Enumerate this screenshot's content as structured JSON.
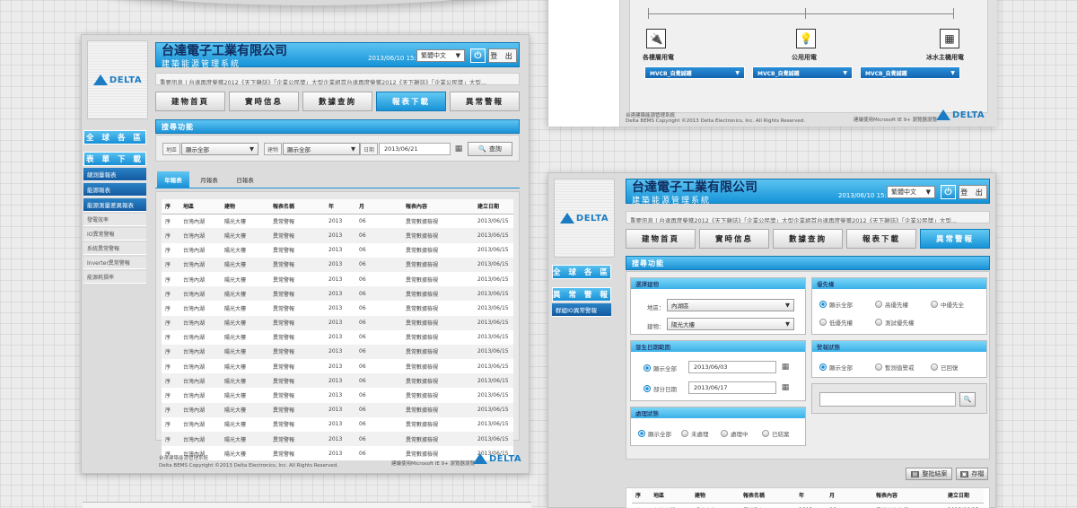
{
  "company": "台達電子工業有限公司",
  "system": "建築能源管理系統",
  "brand": "DELTA",
  "lang": "繁體中文",
  "logout": "登 出",
  "power_icon": "⏻",
  "news": "重要訊息 | 台達再度榮獲2012《天下雜誌》「企業公民獎」大型企業組首台達再度榮獲2012《天下雜誌》「企業公民獎」大型...",
  "tabs": [
    "建物首頁",
    "實時信息",
    "數據查詢",
    "報表下載",
    "異常警報"
  ],
  "footer": {
    "sys": "台達建築能源管理系統",
    "copy": "Delta BEMS Copyright ©2013 Delta Electronics, Inc. All Rights Reserved.",
    "browser": "建議使用Microsoft IE 9+  瀏覽器瀏覽"
  },
  "left": {
    "date": "2013/06/10 15:30",
    "search_title": "搜尋功能",
    "side": {
      "all": "全 球 各 區",
      "download": "表 單 下 載",
      "subs": [
        "總測量報表",
        "能源報表",
        "能源測量差異報表"
      ],
      "items": [
        "發電效率",
        "IO異常警報",
        "系統異常警報",
        "Inverter異常警報",
        "能源耗損率"
      ]
    },
    "filter": {
      "region_label": "地區",
      "region_value": "顯示全部",
      "building_label": "建物",
      "building_value": "顯示全部",
      "date_label": "日期",
      "date_value": "2013/06/21",
      "search_btn": "查詢",
      "search_icon": "🔍",
      "calendar_icon": "▦"
    },
    "subtabs": [
      "年報表",
      "月報表",
      "日報表"
    ],
    "columns": [
      "序",
      "地區",
      "建物",
      "報表名稱",
      "年",
      "月",
      "報表內容",
      "建立日期"
    ],
    "row": [
      "序",
      "台灣內湖",
      "陽光大樓",
      "異常警報",
      "2013",
      "06",
      "異常數據檢視",
      "2013/06/15"
    ],
    "row_count": 17
  },
  "right": {
    "date": "2013/06/10 15:30",
    "search_title": "搜尋功能",
    "side": {
      "all": "全 球 各 區",
      "alarm": "異 常 警 報",
      "sub": "群組IO異常警報"
    },
    "building_group": {
      "title": "選擇建物",
      "region_label": "地區：",
      "region_value": "內湖區",
      "building_label": "建物：",
      "building_value": "陽光大樓"
    },
    "date_group": {
      "title": "發生日期範圍",
      "opt1": "顯示全部",
      "opt1_date": "2013/06/03",
      "opt2": "部分日期",
      "opt2_date": "2013/06/17"
    },
    "process_group": {
      "title": "處理狀態",
      "opts": [
        "顯示全部",
        "未處理",
        "處理中",
        "已結案"
      ]
    },
    "priority_group": {
      "title": "優先權",
      "opts": [
        "顯示全部",
        "高優先權",
        "中優先全",
        "低優先權",
        "測試優先權"
      ]
    },
    "alarm_group": {
      "title": "警報狀態",
      "opts": [
        "顯示全部",
        "暫測值警戒",
        "已回復"
      ]
    },
    "btn_close": "整批結案",
    "btn_save": "存檔",
    "columns": [
      "序",
      "地區",
      "建物",
      "報表名稱",
      "年",
      "月",
      "報表內容",
      "建立日期"
    ]
  },
  "diagram": {
    "labels": [
      "各樓層用電",
      "公用用電",
      "冰水主機用電"
    ],
    "select": "MVCB_自覺誠鐵",
    "copy": "Delta BEMS Copyright ©2013 Delta Electronics, Inc. All Rights Reserved."
  }
}
